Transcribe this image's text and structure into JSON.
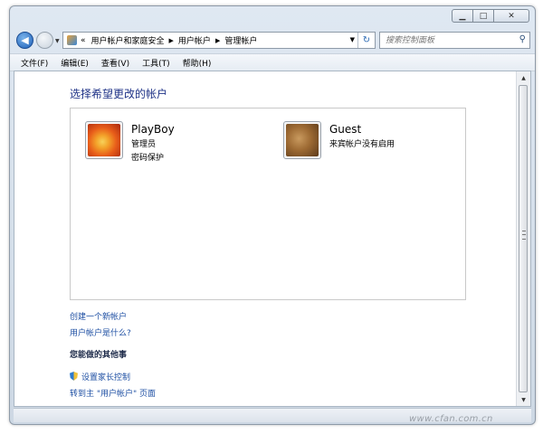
{
  "window": {
    "controls": {
      "minimize": "▁",
      "maximize": "□",
      "close": "✕"
    }
  },
  "nav": {
    "back_icon": "back-arrow-icon",
    "forward_icon": "forward-arrow-icon",
    "address": {
      "prefix": "«",
      "crumbs": [
        "用户帐户和家庭安全",
        "用户帐户",
        "管理帐户"
      ]
    },
    "search": {
      "placeholder": "搜索控制面板"
    }
  },
  "menu": [
    {
      "label": "文件(F)"
    },
    {
      "label": "编辑(E)"
    },
    {
      "label": "查看(V)"
    },
    {
      "label": "工具(T)"
    },
    {
      "label": "帮助(H)"
    }
  ],
  "main": {
    "heading": "选择希望更改的帐户",
    "accounts": [
      {
        "name": "PlayBoy",
        "line1": "管理员",
        "line2": "密码保护",
        "icon": "flower-avatar"
      },
      {
        "name": "Guest",
        "line1": "来宾帐户没有启用",
        "line2": "",
        "icon": "luggage-avatar"
      }
    ],
    "links": {
      "create": "创建一个新帐户",
      "what_is": "用户帐户是什么?"
    },
    "other_tasks": {
      "heading": "您能做的其他事",
      "parental": "设置家长控制",
      "goto": "转到主 \"用户帐户\" 页面"
    }
  },
  "watermark": "www.cfan.com.cn"
}
